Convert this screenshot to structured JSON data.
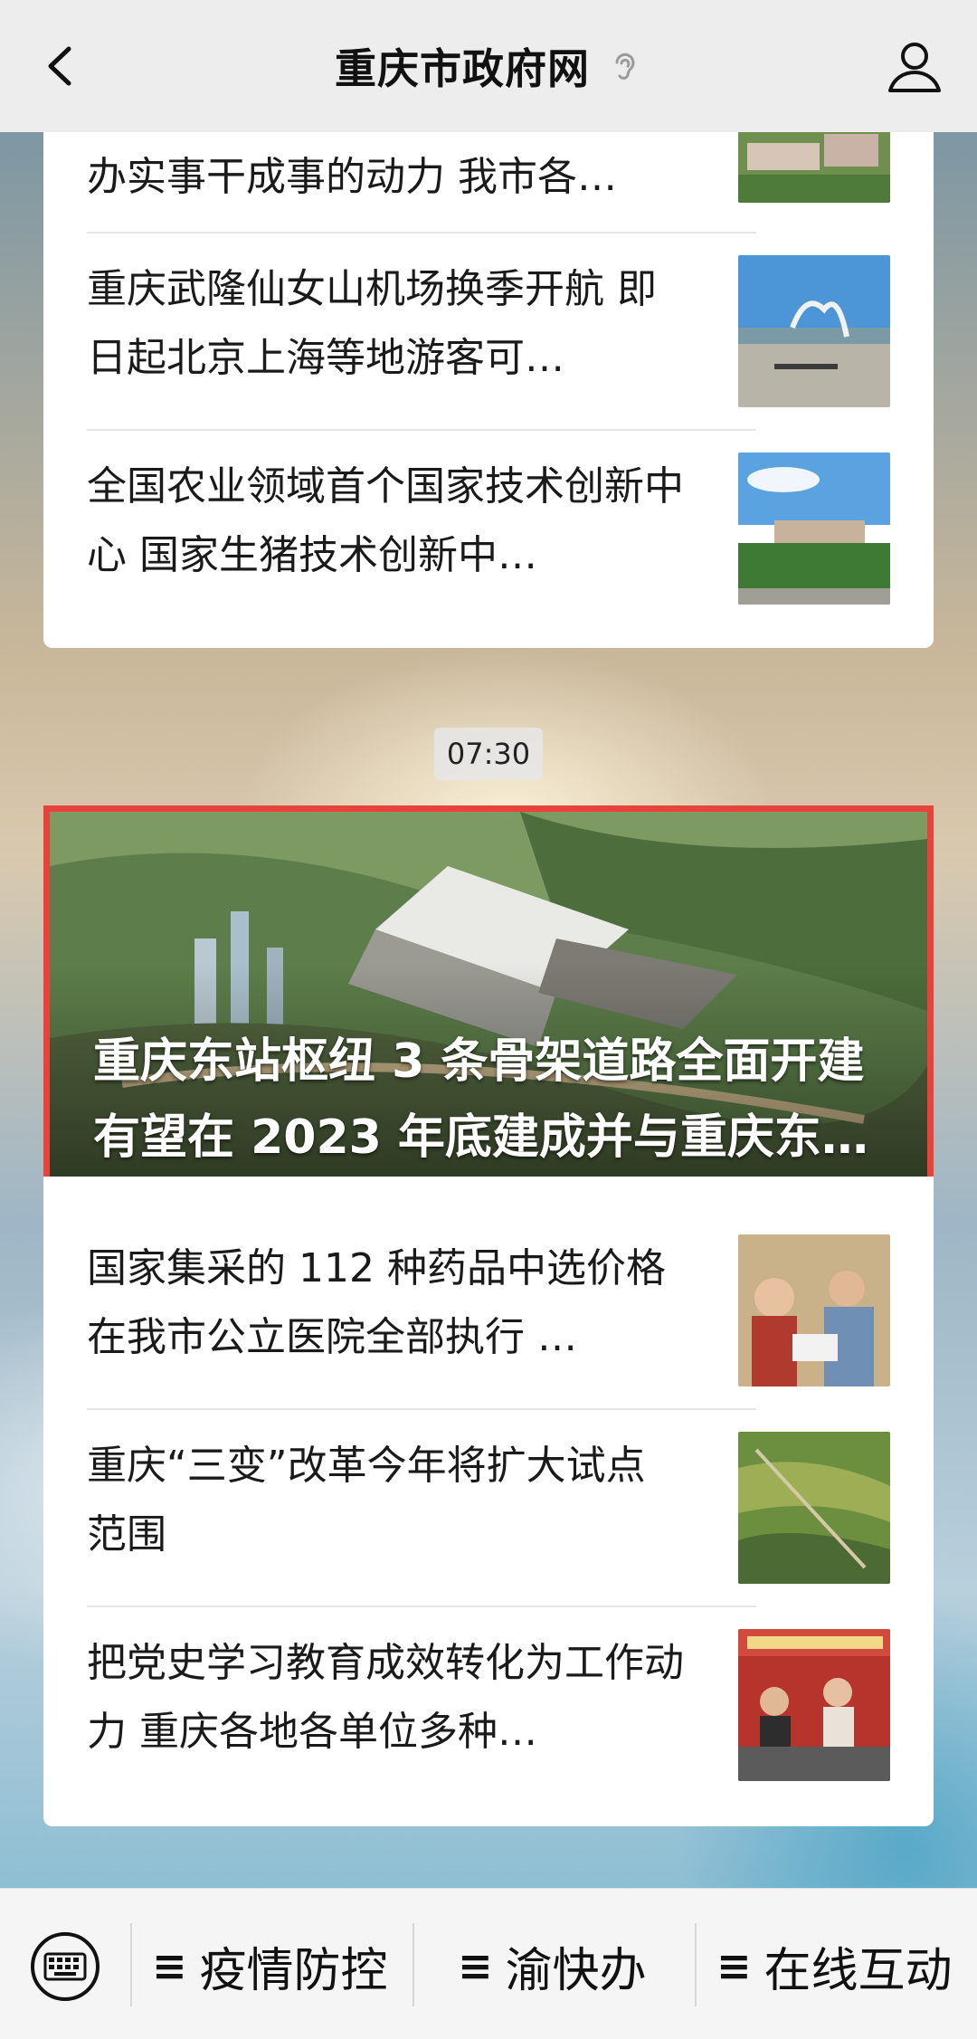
{
  "header": {
    "title": "重庆市政府网"
  },
  "news_top": [
    {
      "text": "办实事干成事的动力 我市各…"
    },
    {
      "text": "重庆武隆仙女山机场换季开航 即日起北京上海等地游客可…"
    },
    {
      "text": "全国农业领域首个国家技术创新中心 国家生猪技术创新中…"
    }
  ],
  "time_label": "07:30",
  "hero": {
    "headline": "重庆东站枢纽 3 条骨架道路全面开建 有望在 2023 年底建成并与重庆东…"
  },
  "news_bottom": [
    {
      "text": "国家集采的 112 种药品中选价格在我市公立医院全部执行 …"
    },
    {
      "text": "重庆“三变”改革今年将扩大试点范围"
    },
    {
      "text": "把党史学习教育成效转化为工作动力 重庆各地各单位多种…"
    }
  ],
  "bottom_menu": [
    {
      "label": "疫情防控"
    },
    {
      "label": "渝快办"
    },
    {
      "label": "在线互动"
    }
  ],
  "colors": {
    "highlight_border": "#e8433a"
  }
}
